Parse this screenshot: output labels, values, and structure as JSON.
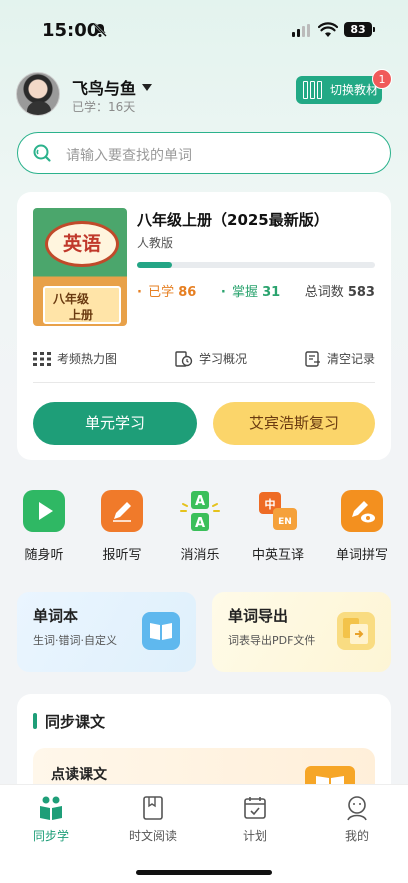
{
  "status_bar": {
    "time": "15:00",
    "battery": "83",
    "icons": [
      "bell-off-icon",
      "cell-signal-icon",
      "wifi-icon",
      "battery-icon"
    ]
  },
  "profile": {
    "name": "飞鸟与鱼",
    "learned_days": "已学：16天",
    "switch_label": "切换教材",
    "switch_badge": "1"
  },
  "search": {
    "placeholder": "请输入要查找的单词"
  },
  "book": {
    "cover_title": "英语",
    "cover_grade_line1": "八年级",
    "cover_grade_line2": "上册",
    "title": "八年级上册（2025最新版）",
    "publisher": "人教版",
    "progress": 0.148,
    "learned_label": "已学",
    "learned_value": "86",
    "mastered_label": "掌握",
    "mastered_value": "31",
    "total_label": "总词数",
    "total_value": "583",
    "tools": [
      "考频热力图",
      "学习概况",
      "清空记录"
    ],
    "unit_study": "单元学习",
    "review": "艾宾浩斯复习"
  },
  "quick_actions": [
    {
      "label": "随身听",
      "icon": "play-icon",
      "color": "#2fb864"
    },
    {
      "label": "报听写",
      "icon": "pencil-icon",
      "color": "#f07a2a"
    },
    {
      "label": "消消乐",
      "icon": "aa-match-icon",
      "color": "#3bbf5a"
    },
    {
      "label": "中英互译",
      "icon": "translate-icon",
      "color": "#ee6b25"
    },
    {
      "label": "单词拼写",
      "icon": "spell-icon",
      "color": "#f3901f"
    }
  ],
  "word_book": {
    "title": "单词本",
    "subtitle": "生词·错词·自定义"
  },
  "word_export": {
    "title": "单词导出",
    "subtitle": "词表导出PDF文件"
  },
  "sync": {
    "title": "同步课文",
    "read_title": "点读课文"
  },
  "tabs": [
    {
      "label": "同步学",
      "active": true
    },
    {
      "label": "时文阅读",
      "active": false
    },
    {
      "label": "计划",
      "active": false
    },
    {
      "label": "我的",
      "active": false
    }
  ],
  "colors": {
    "accent": "#1e9e78",
    "review": "#fbd56a",
    "learned": "#e67f22",
    "mastered": "#2aa36e"
  }
}
